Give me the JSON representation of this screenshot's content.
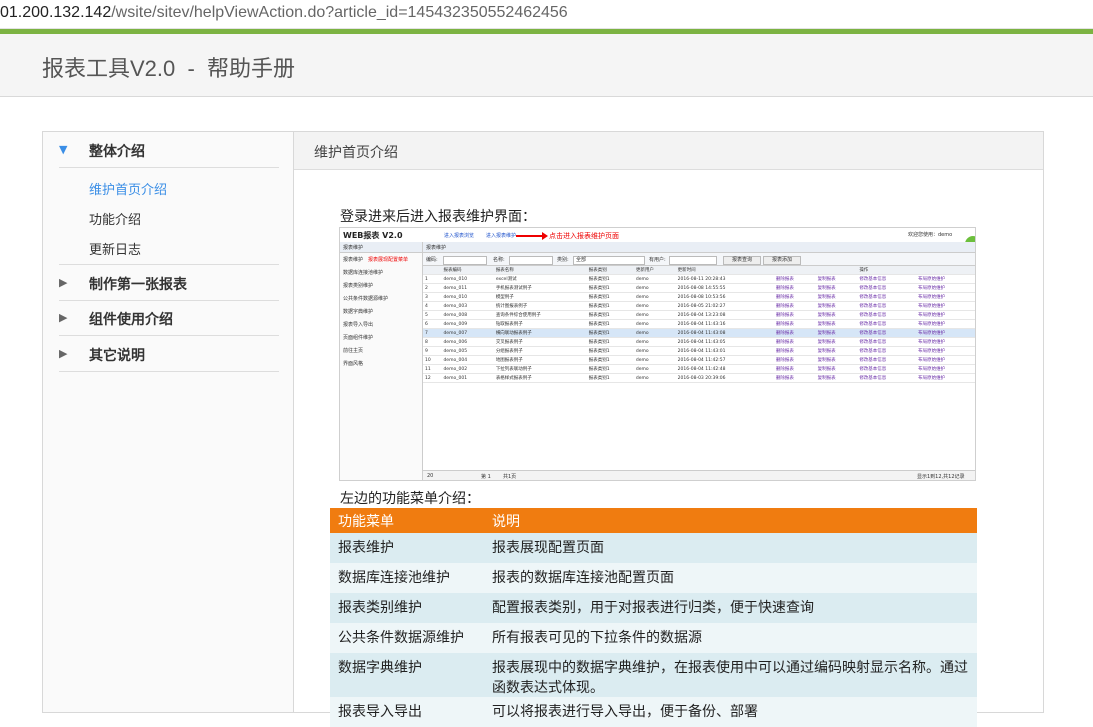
{
  "browser": {
    "url_host": "01.200.132.142",
    "url_path": "/wsite/sitev/helpViewAction.do?article_id=145432350552462456"
  },
  "header": {
    "title": "报表工具V2.0  -  帮助手册"
  },
  "sidebar": {
    "sections": [
      {
        "label": "整体介绍",
        "expanded": true,
        "items": [
          {
            "label": "维护首页介绍",
            "active": true
          },
          {
            "label": "功能介绍"
          },
          {
            "label": "更新日志"
          }
        ]
      },
      {
        "label": "制作第一张报表",
        "expanded": false
      },
      {
        "label": "组件使用介绍",
        "expanded": false
      },
      {
        "label": "其它说明",
        "expanded": false
      }
    ]
  },
  "main": {
    "title": "维护首页介绍",
    "intro_text": "登录进来后进入报表维护界面：",
    "menu_intro_text": "左边的功能菜单介绍："
  },
  "screenshot": {
    "logo": "WEB报表 V2.0",
    "nav1": "进入报表浏览",
    "nav2": "进入报表维护",
    "note": "点击进入报表维护页面",
    "welcome": "欢迎您使用：demo",
    "left_head": "报表维护",
    "left_items": [
      "报表维护",
      "数据库连接池维护",
      "报表类别维护",
      "公共条件数据源维护",
      "数据字典维护",
      "报表导入导出",
      "页面组件维护",
      "前往主页",
      "界面风格"
    ],
    "left_note": "报表展现配置菜单",
    "right_head": "报表维护",
    "filter": {
      "label_code": "编码:",
      "label_name": "名称:",
      "label_type": "类别:",
      "type_value": "全部",
      "label_user": "有用户:",
      "btn_query": "报表查询",
      "btn_add": "报表添加"
    },
    "columns": [
      "",
      "报表编码",
      "报表名称",
      "报表类别",
      "更新用户",
      "更新时间",
      "",
      "",
      "操作",
      ""
    ],
    "rows": [
      [
        "1",
        "demo_010",
        "excel测试",
        "报表类别1",
        "demo",
        "2016-08-11 20:28:43",
        "删除报表",
        "复制报表",
        "修改基本信息",
        "布局原始维护"
      ],
      [
        "2",
        "demo_011",
        "手机报表测试例子",
        "报表类别1",
        "demo",
        "2016-08-08 14:55:55",
        "删除报表",
        "复制报表",
        "修改基本信息",
        "布局原始维护"
      ],
      [
        "3",
        "demo_010",
        "模型例子",
        "报表类别1",
        "demo",
        "2016-08-08 10:53:56",
        "删除报表",
        "复制报表",
        "修改基本信息",
        "布局原始维护"
      ],
      [
        "4",
        "demo_003",
        "统计图报表例子",
        "报表类别1",
        "demo",
        "2016-08-05 21:02:27",
        "删除报表",
        "复制报表",
        "修改基本信息",
        "布局原始维护"
      ],
      [
        "5",
        "demo_008",
        "查询条件综合使用例子",
        "报表类别1",
        "demo",
        "2016-08-04 13:23:08",
        "删除报表",
        "复制报表",
        "修改基本信息",
        "布局原始维护"
      ],
      [
        "6",
        "demo_009",
        "钻取报表例子",
        "报表类别1",
        "demo",
        "2016-08-04 11:43:16",
        "删除报表",
        "复制报表",
        "修改基本信息",
        "布局原始维护"
      ],
      [
        "7",
        "demo_007",
        "横向联动报表例子",
        "报表类别1",
        "demo",
        "2016-08-04 11:43:08",
        "删除报表",
        "复制报表",
        "修改基本信息",
        "布局原始维护"
      ],
      [
        "8",
        "demo_006",
        "交叉报表例子",
        "报表类别1",
        "demo",
        "2016-08-04 11:43:05",
        "删除报表",
        "复制报表",
        "修改基本信息",
        "布局原始维护"
      ],
      [
        "9",
        "demo_005",
        "分组报表例子",
        "报表类别1",
        "demo",
        "2016-08-04 11:43:01",
        "删除报表",
        "复制报表",
        "修改基本信息",
        "布局原始维护"
      ],
      [
        "10",
        "demo_004",
        "地图报表例子",
        "报表类别1",
        "demo",
        "2016-08-04 11:42:57",
        "删除报表",
        "复制报表",
        "修改基本信息",
        "布局原始维护"
      ],
      [
        "11",
        "demo_002",
        "下拉列表联动例子",
        "报表类别1",
        "demo",
        "2016-08-04 11:42:48",
        "删除报表",
        "复制报表",
        "修改基本信息",
        "布局原始维护"
      ],
      [
        "12",
        "demo_001",
        "表格样式报表例子",
        "报表类别1",
        "demo",
        "2016-08-03 20:39:06",
        "删除报表",
        "复制报表",
        "修改基本信息",
        "布局原始维护"
      ]
    ],
    "highlight_row": 7,
    "pager": {
      "size": "20",
      "page_label": "第 1",
      "page_total": "共1页",
      "summary": "显示1到12,共12记录"
    }
  },
  "func_table": {
    "headers": [
      "功能菜单",
      "说明"
    ],
    "rows": [
      [
        "报表维护",
        "报表展现配置页面"
      ],
      [
        "数据库连接池维护",
        "报表的数据库连接池配置页面"
      ],
      [
        "报表类别维护",
        "配置报表类别，用于对报表进行归类，便于快速查询"
      ],
      [
        "公共条件数据源维护",
        "所有报表可见的下拉条件的数据源"
      ],
      [
        "数据字典维护",
        "报表展现中的数据字典维护，在报表使用中可以通过编码映射显示名称。通过函数表达式体现。"
      ],
      [
        "报表导入导出",
        "可以将报表进行导入导出，便于备份、部署"
      ]
    ]
  },
  "colors": {
    "accent_green": "#7cb342",
    "table_header": "#f07c10",
    "active_link": "#3a8ee6"
  }
}
